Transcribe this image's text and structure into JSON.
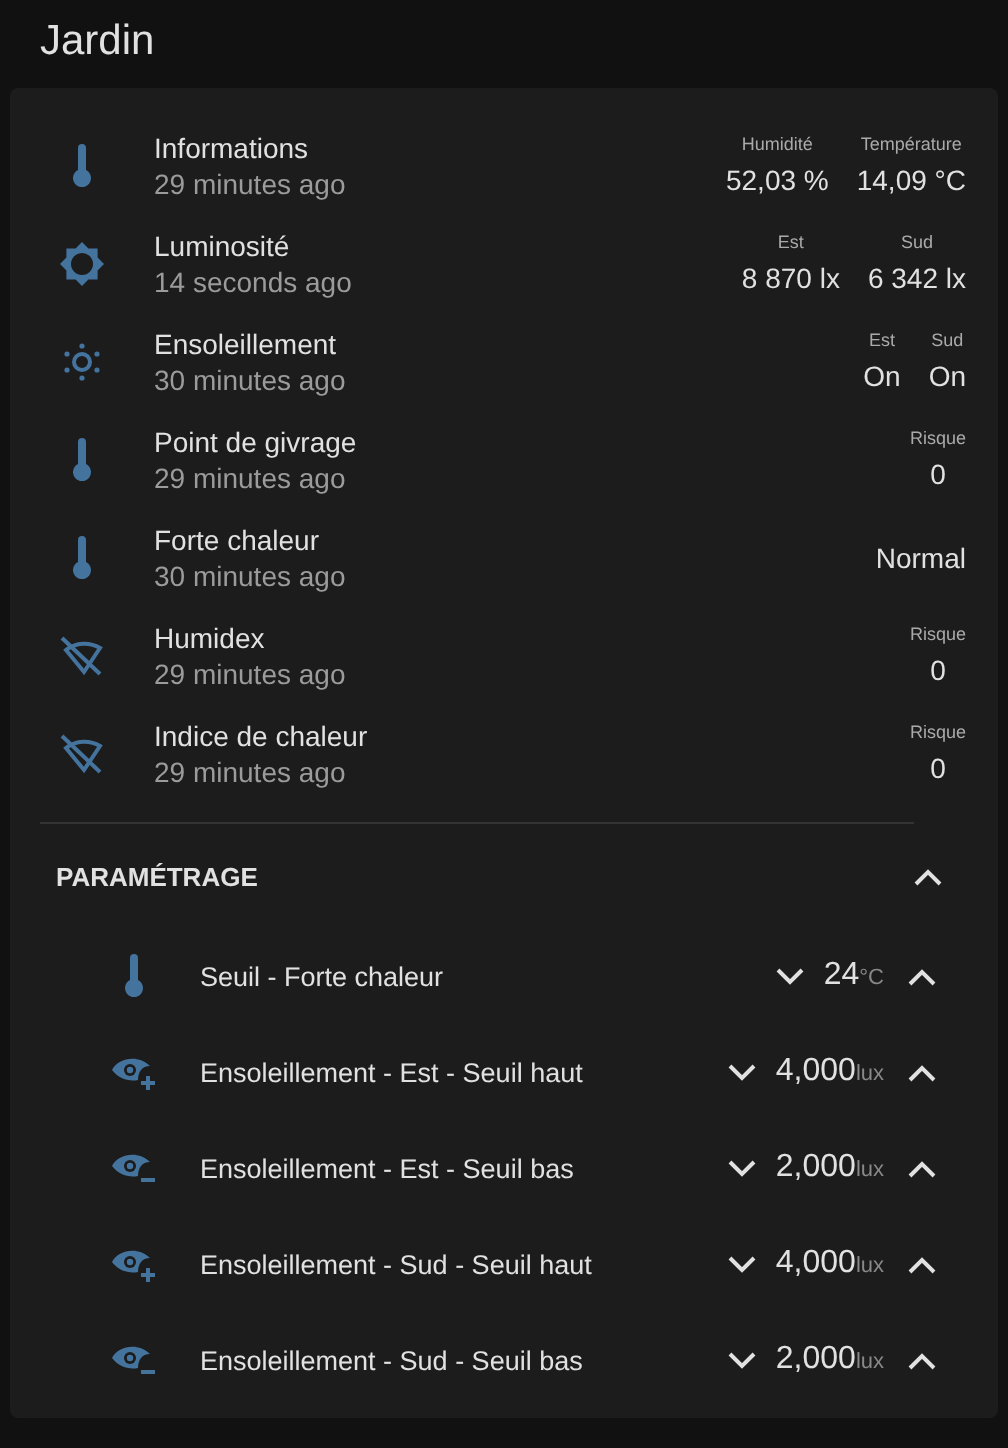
{
  "page": {
    "title": "Jardin"
  },
  "entities": [
    {
      "kind": "thermometer",
      "name": "Informations",
      "time": "29 minutes ago",
      "attributes": [
        {
          "label": "Humidité",
          "value": "52,03 %"
        },
        {
          "label": "Température",
          "value": "14,09 °C"
        }
      ]
    },
    {
      "kind": "brightness",
      "name": "Luminosité",
      "time": "14 seconds ago",
      "attributes": [
        {
          "label": "Est",
          "value": "8 870 lx"
        },
        {
          "label": "Sud",
          "value": "6 342 lx"
        }
      ]
    },
    {
      "kind": "sun",
      "name": "Ensoleillement",
      "time": "30 minutes ago",
      "attributes": [
        {
          "label": "Est",
          "value": "On"
        },
        {
          "label": "Sud",
          "value": "On"
        }
      ]
    },
    {
      "kind": "thermometer",
      "name": "Point de givrage",
      "time": "29 minutes ago",
      "attributes": [
        {
          "label": "Risque",
          "value": "0"
        }
      ]
    },
    {
      "kind": "thermometer",
      "name": "Forte chaleur",
      "time": "30 minutes ago",
      "state": "Normal"
    },
    {
      "kind": "cone",
      "name": "Humidex",
      "time": "29 minutes ago",
      "attributes": [
        {
          "label": "Risque",
          "value": "0"
        }
      ]
    },
    {
      "kind": "cone",
      "name": "Indice de chaleur",
      "time": "29 minutes ago",
      "attributes": [
        {
          "label": "Risque",
          "value": "0"
        }
      ]
    }
  ],
  "settings": {
    "title": "PARAMÉTRAGE",
    "expanded": true,
    "items": [
      {
        "kind": "thermometer",
        "name": "Seuil - Forte chaleur",
        "value": "24",
        "unit": "°C"
      },
      {
        "kind": "high",
        "name": "Ensoleillement - Est - Seuil haut",
        "value": "4,000",
        "unit": "lux"
      },
      {
        "kind": "low",
        "name": "Ensoleillement - Est - Seuil bas",
        "value": "2,000",
        "unit": "lux"
      },
      {
        "kind": "high",
        "name": "Ensoleillement - Sud - Seuil haut",
        "value": "4,000",
        "unit": "lux"
      },
      {
        "kind": "low",
        "name": "Ensoleillement - Sud - Seuil bas",
        "value": "2,000",
        "unit": "lux"
      }
    ]
  }
}
